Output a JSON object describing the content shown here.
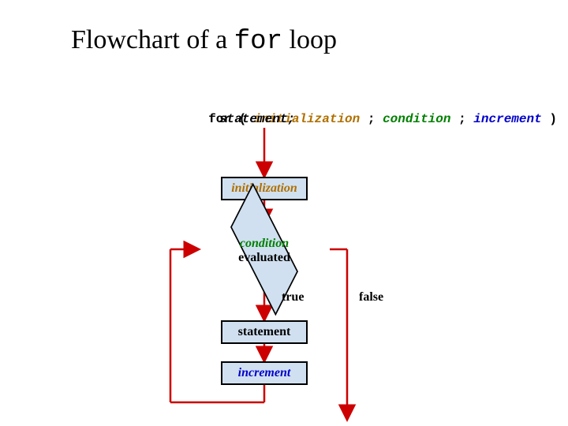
{
  "title": {
    "prefix": "Flowchart of a ",
    "code": "for",
    "suffix": " loop"
  },
  "syntax": {
    "for_kw": "for",
    "open": " ( ",
    "init": "initialization",
    "sep1": " ; ",
    "cond": "condition",
    "sep2": " ; ",
    "incr": "increment",
    "close": " )",
    "stmt": "statement;"
  },
  "flow": {
    "box_init": "initialization",
    "diamond_line1": "condition",
    "diamond_line2": "evaluated",
    "label_true": "true",
    "label_false": "false",
    "box_stmt": "statement",
    "box_incr": "increment"
  },
  "colors": {
    "init": "#b07000",
    "cond": "#008000",
    "incr": "#0000cc",
    "arrow_red": "#cc0000",
    "box_fill": "#d0e0f0"
  }
}
